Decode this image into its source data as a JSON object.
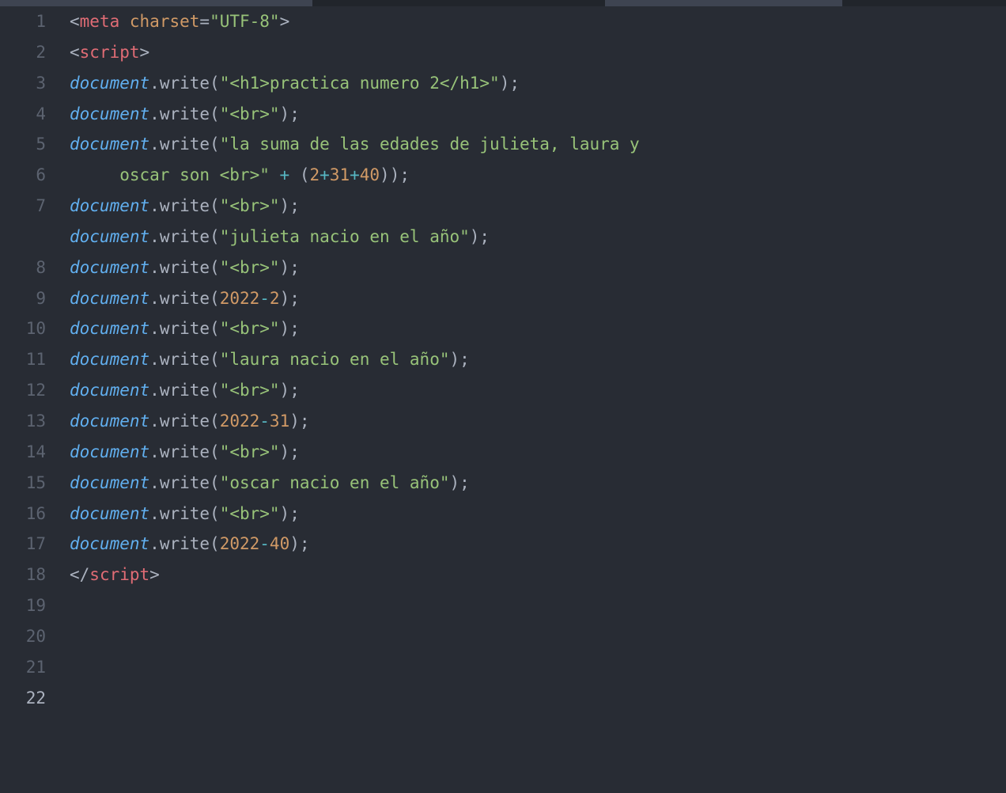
{
  "gutter": {
    "lines": [
      "1",
      "2",
      "3",
      "4",
      "5",
      "6",
      "7",
      "8",
      "9",
      "10",
      "11",
      "12",
      "13",
      "14",
      "15",
      "16",
      "17",
      "18",
      "19",
      "20",
      "21",
      "22"
    ],
    "active_index": 21
  },
  "code": {
    "lines": [
      [
        {
          "c": "p",
          "t": "<"
        },
        {
          "c": "t",
          "t": "meta"
        },
        {
          "c": "p",
          "t": " "
        },
        {
          "c": "a",
          "t": "charset"
        },
        {
          "c": "p",
          "t": "="
        },
        {
          "c": "s",
          "t": "\"UTF-8\""
        },
        {
          "c": "p",
          "t": ">"
        }
      ],
      [
        {
          "c": "p",
          "t": ""
        }
      ],
      [
        {
          "c": "p",
          "t": "<"
        },
        {
          "c": "t",
          "t": "script"
        },
        {
          "c": "p",
          "t": ">"
        }
      ],
      [
        {
          "c": "p",
          "t": ""
        }
      ],
      [
        {
          "c": "oi",
          "t": "document"
        },
        {
          "c": "p",
          "t": "."
        },
        {
          "c": "m",
          "t": "write"
        },
        {
          "c": "p",
          "t": "("
        },
        {
          "c": "s",
          "t": "\"<h1>practica numero 2</h1>\""
        },
        {
          "c": "p",
          "t": ");"
        }
      ],
      [
        {
          "c": "oi",
          "t": "document"
        },
        {
          "c": "p",
          "t": "."
        },
        {
          "c": "m",
          "t": "write"
        },
        {
          "c": "p",
          "t": "("
        },
        {
          "c": "s",
          "t": "\"<br>\""
        },
        {
          "c": "p",
          "t": ");"
        }
      ],
      [
        {
          "c": "oi",
          "t": "document"
        },
        {
          "c": "p",
          "t": "."
        },
        {
          "c": "m",
          "t": "write"
        },
        {
          "c": "p",
          "t": "("
        },
        {
          "c": "s",
          "t": "\"la suma de las edades de julieta, laura y "
        }
      ],
      [
        {
          "c": "s",
          "t": "     oscar son <br>\""
        },
        {
          "c": "p",
          "t": " "
        },
        {
          "c": "op",
          "t": "+"
        },
        {
          "c": "p",
          "t": " ("
        },
        {
          "c": "n",
          "t": "2"
        },
        {
          "c": "op",
          "t": "+"
        },
        {
          "c": "n",
          "t": "31"
        },
        {
          "c": "op",
          "t": "+"
        },
        {
          "c": "n",
          "t": "40"
        },
        {
          "c": "p",
          "t": "));"
        }
      ],
      [
        {
          "c": "oi",
          "t": "document"
        },
        {
          "c": "p",
          "t": "."
        },
        {
          "c": "m",
          "t": "write"
        },
        {
          "c": "p",
          "t": "("
        },
        {
          "c": "s",
          "t": "\"<br>\""
        },
        {
          "c": "p",
          "t": ");"
        }
      ],
      [
        {
          "c": "oi",
          "t": "document"
        },
        {
          "c": "p",
          "t": "."
        },
        {
          "c": "m",
          "t": "write"
        },
        {
          "c": "p",
          "t": "("
        },
        {
          "c": "s",
          "t": "\"julieta nacio en el año\""
        },
        {
          "c": "p",
          "t": ");"
        }
      ],
      [
        {
          "c": "oi",
          "t": "document"
        },
        {
          "c": "p",
          "t": "."
        },
        {
          "c": "m",
          "t": "write"
        },
        {
          "c": "p",
          "t": "("
        },
        {
          "c": "s",
          "t": "\"<br>\""
        },
        {
          "c": "p",
          "t": ");"
        }
      ],
      [
        {
          "c": "oi",
          "t": "document"
        },
        {
          "c": "p",
          "t": "."
        },
        {
          "c": "m",
          "t": "write"
        },
        {
          "c": "p",
          "t": "("
        },
        {
          "c": "n",
          "t": "2022"
        },
        {
          "c": "op",
          "t": "-"
        },
        {
          "c": "n",
          "t": "2"
        },
        {
          "c": "p",
          "t": ");"
        }
      ],
      [
        {
          "c": "oi",
          "t": "document"
        },
        {
          "c": "p",
          "t": "."
        },
        {
          "c": "m",
          "t": "write"
        },
        {
          "c": "p",
          "t": "("
        },
        {
          "c": "s",
          "t": "\"<br>\""
        },
        {
          "c": "p",
          "t": ");"
        }
      ],
      [
        {
          "c": "oi",
          "t": "document"
        },
        {
          "c": "p",
          "t": "."
        },
        {
          "c": "m",
          "t": "write"
        },
        {
          "c": "p",
          "t": "("
        },
        {
          "c": "s",
          "t": "\"laura nacio en el año\""
        },
        {
          "c": "p",
          "t": ");"
        }
      ],
      [
        {
          "c": "oi",
          "t": "document"
        },
        {
          "c": "p",
          "t": "."
        },
        {
          "c": "m",
          "t": "write"
        },
        {
          "c": "p",
          "t": "("
        },
        {
          "c": "s",
          "t": "\"<br>\""
        },
        {
          "c": "p",
          "t": ");"
        }
      ],
      [
        {
          "c": "oi",
          "t": "document"
        },
        {
          "c": "p",
          "t": "."
        },
        {
          "c": "m",
          "t": "write"
        },
        {
          "c": "p",
          "t": "("
        },
        {
          "c": "n",
          "t": "2022"
        },
        {
          "c": "op",
          "t": "-"
        },
        {
          "c": "n",
          "t": "31"
        },
        {
          "c": "p",
          "t": ");"
        }
      ],
      [
        {
          "c": "oi",
          "t": "document"
        },
        {
          "c": "p",
          "t": "."
        },
        {
          "c": "m",
          "t": "write"
        },
        {
          "c": "p",
          "t": "("
        },
        {
          "c": "s",
          "t": "\"<br>\""
        },
        {
          "c": "p",
          "t": ");"
        }
      ],
      [
        {
          "c": "oi",
          "t": "document"
        },
        {
          "c": "p",
          "t": "."
        },
        {
          "c": "m",
          "t": "write"
        },
        {
          "c": "p",
          "t": "("
        },
        {
          "c": "s",
          "t": "\"oscar nacio en el año\""
        },
        {
          "c": "p",
          "t": ");"
        }
      ],
      [
        {
          "c": "oi",
          "t": "document"
        },
        {
          "c": "p",
          "t": "."
        },
        {
          "c": "m",
          "t": "write"
        },
        {
          "c": "p",
          "t": "("
        },
        {
          "c": "s",
          "t": "\"<br>\""
        },
        {
          "c": "p",
          "t": ");"
        }
      ],
      [
        {
          "c": "oi",
          "t": "document"
        },
        {
          "c": "p",
          "t": "."
        },
        {
          "c": "m",
          "t": "write"
        },
        {
          "c": "p",
          "t": "("
        },
        {
          "c": "n",
          "t": "2022"
        },
        {
          "c": "op",
          "t": "-"
        },
        {
          "c": "n",
          "t": "40"
        },
        {
          "c": "p",
          "t": ");"
        }
      ],
      [
        {
          "c": "p",
          "t": ""
        }
      ],
      [
        {
          "c": "p",
          "t": "</"
        },
        {
          "c": "t",
          "t": "script"
        },
        {
          "c": "p",
          "t": ">"
        }
      ],
      [
        {
          "c": "p",
          "t": ""
        }
      ]
    ],
    "wrap_indices": [
      7
    ],
    "active_index": 22
  }
}
